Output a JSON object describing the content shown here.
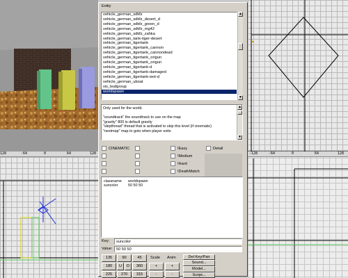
{
  "entity_window": {
    "title": "Entity",
    "classnames": [
      "vehicle_german_sdkfz",
      "vehicle_german_sdkfz_desert_d",
      "vehicle_german_sdkfz_green_d",
      "vehicle_german_sdkfz_mg42",
      "vehicle_german_sdkfz_zahka",
      "vehicle_german_tank-tiger-desert",
      "vehicle_german_tigertank",
      "vehicle_german_tigertank_cannon",
      "vehicle_german_tigertank_cannondead",
      "vehicle_german_tigertank_origun",
      "vehicle_german_tigertank_origun",
      "vehicle_german_tigertank-d",
      "vehicle_german_tigertank-damaged",
      "vehicle_german_tigertank-wot-d",
      "vehicle_german_uboat",
      "vis_leafgroup",
      "worldspawn"
    ],
    "selected_index": 16,
    "comment_lines": [
      "Only used for the world.",
      "",
      "\"soundtrack\" the soundtrack to use on the map",
      "\"gravity\"  800 is default gravity",
      "\"skipthread\" thread that is activated to skip this level (if cinematic)",
      "\"nextmap\"    map to goto when player exits"
    ],
    "spawnflags": {
      "col1": [
        "CINEMATIC",
        "",
        "",
        ""
      ],
      "col3": [
        "!Easy",
        "!Medium",
        "!Hard",
        "!DeathMatch"
      ],
      "col4": [
        "Detail"
      ]
    },
    "properties": [
      {
        "key": "classname",
        "value": "worldspawn"
      },
      {
        "key": "suncolor",
        "value": "50 50 50"
      }
    ],
    "key_label": "Key:",
    "key_value": "suncolor",
    "value_label": "Value:",
    "value_value": "50 50 50",
    "angle_buttons": [
      [
        "135",
        "90",
        "45"
      ],
      [
        "180",
        "U",
        "D",
        "360"
      ],
      [
        "225",
        "270",
        "315"
      ]
    ],
    "scale_label": "Scale",
    "anim_label": "Anim",
    "plus": "+",
    "minus": "-",
    "action_buttons": [
      "Del Key/Pair",
      "Sound...",
      "Model...",
      "Script..."
    ]
  },
  "rulers": {
    "left": [
      "128",
      "-64",
      "0",
      "64",
      "128"
    ],
    "right": [
      "-128",
      "-64",
      "0",
      "64",
      "128"
    ]
  },
  "colors": {
    "window_face": "#d4d0c8",
    "selection": "#0a246a",
    "grid_bg": "#e9e9e9",
    "grid_line": "#b9b9b9",
    "brush_line": "#000000",
    "yellow_brush": "#d8d800",
    "green_brush": "#58c858",
    "blue_line": "#1a2bd8"
  }
}
